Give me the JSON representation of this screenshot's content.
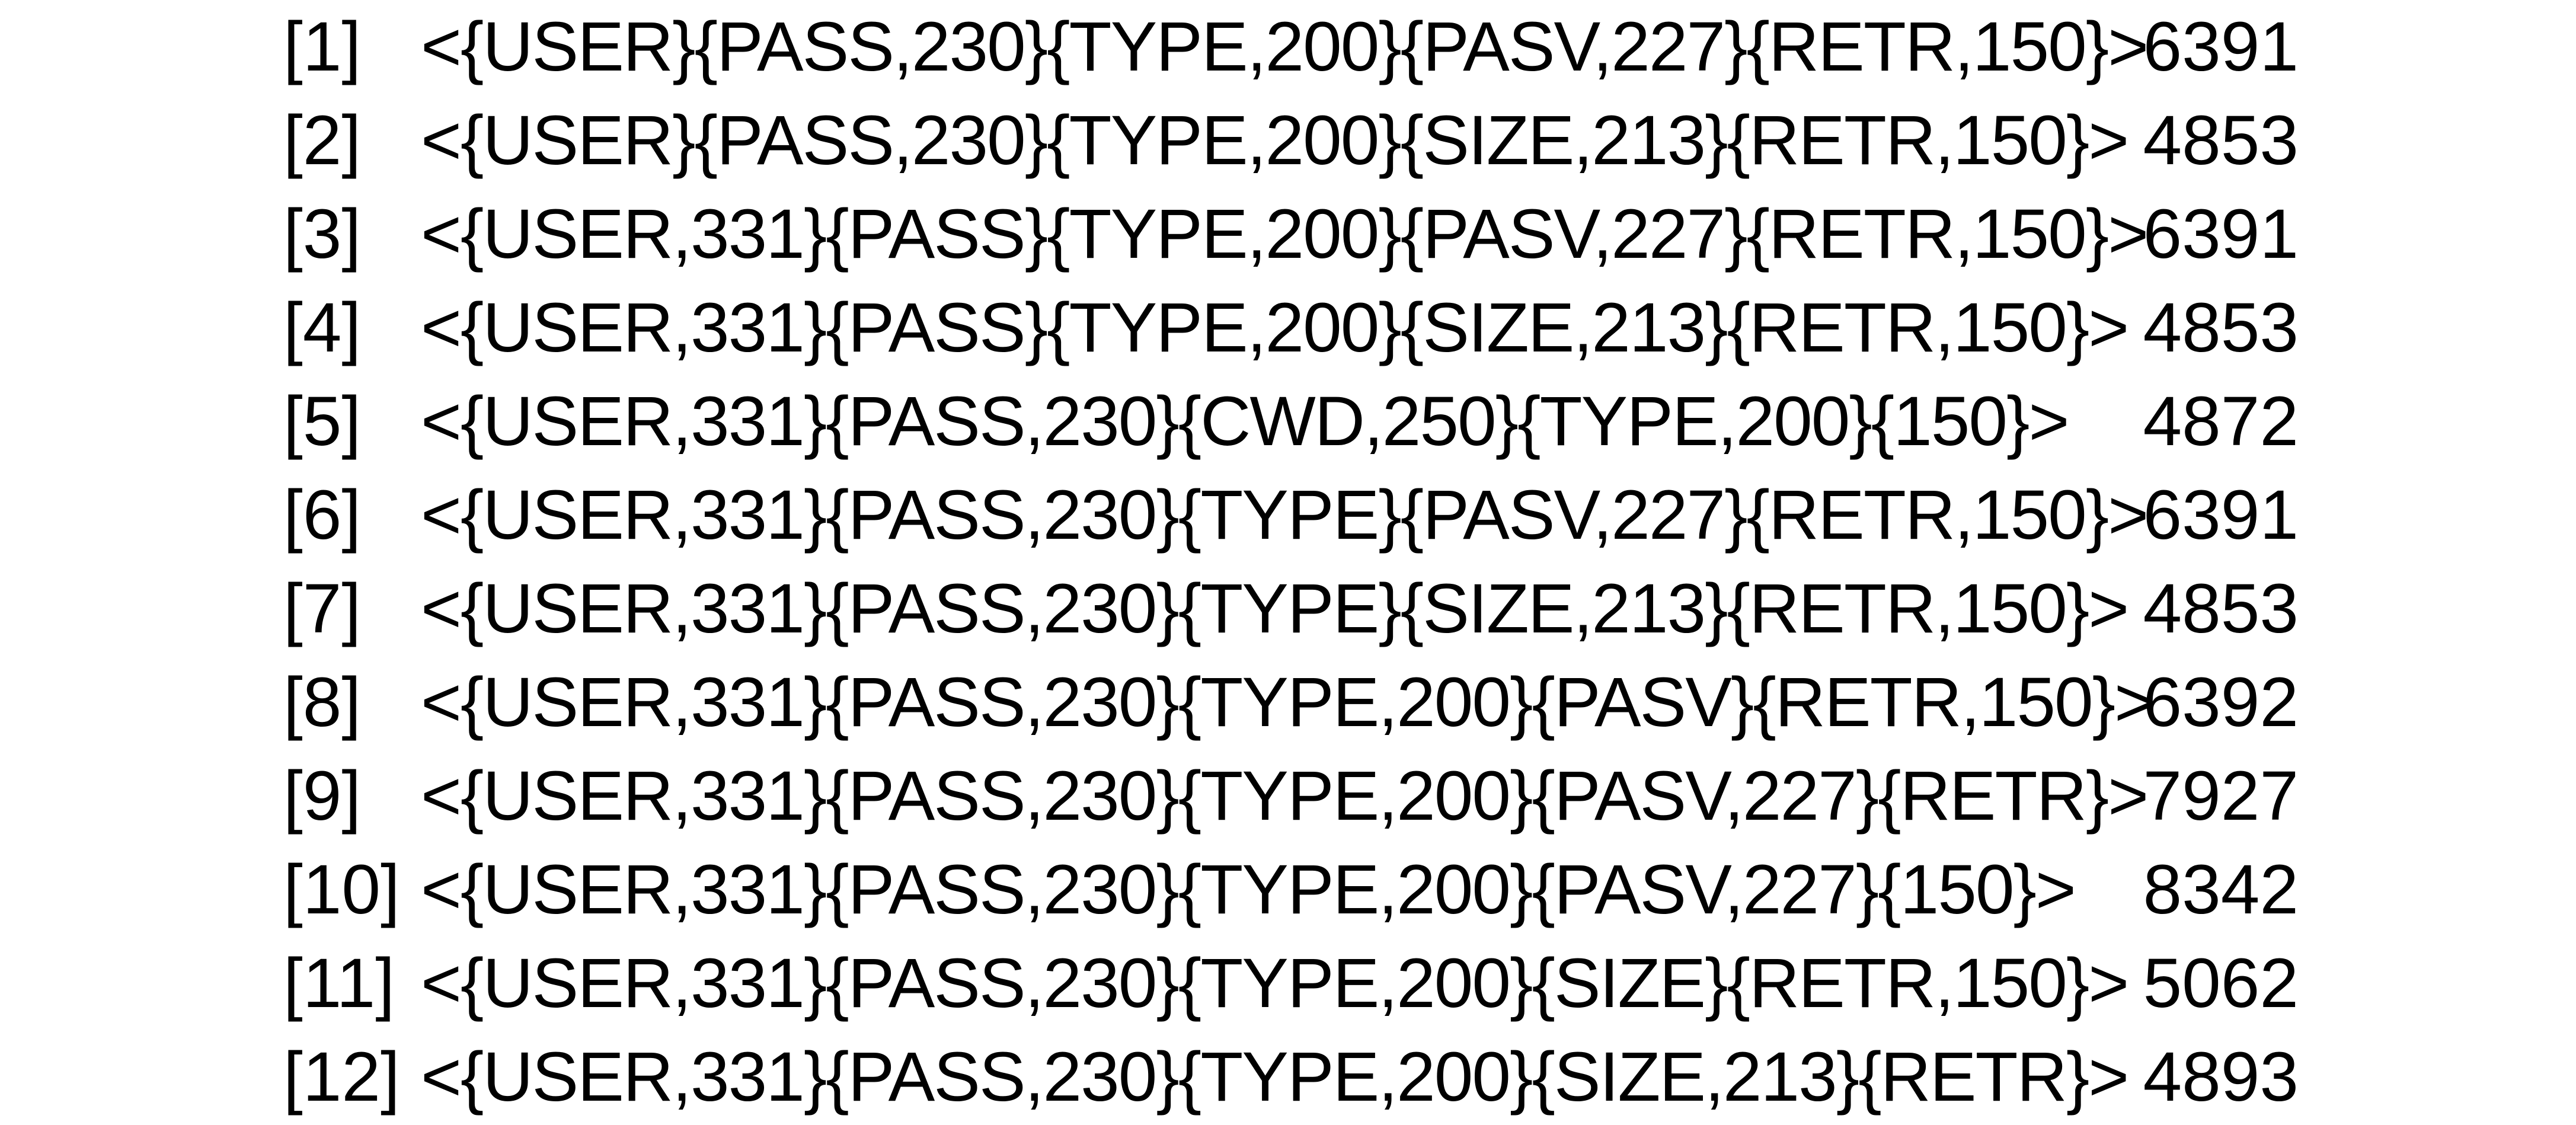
{
  "rows": [
    {
      "index": "[1]",
      "pattern": "<{USER}{PASS,230}{TYPE,200}{PASV,227}{RETR,150}>",
      "count": "6391"
    },
    {
      "index": "[2]",
      "pattern": "<{USER}{PASS,230}{TYPE,200}{SIZE,213}{RETR,150}>",
      "count": "4853"
    },
    {
      "index": "[3]",
      "pattern": "<{USER,331}{PASS}{TYPE,200}{PASV,227}{RETR,150}>",
      "count": "6391"
    },
    {
      "index": "[4]",
      "pattern": "<{USER,331}{PASS}{TYPE,200}{SIZE,213}{RETR,150}>",
      "count": "4853"
    },
    {
      "index": "[5]",
      "pattern": "<{USER,331}{PASS,230}{CWD,250}{TYPE,200}{150}>",
      "count": "4872"
    },
    {
      "index": "[6]",
      "pattern": "<{USER,331}{PASS,230}{TYPE}{PASV,227}{RETR,150}>",
      "count": "6391"
    },
    {
      "index": "[7]",
      "pattern": "<{USER,331}{PASS,230}{TYPE}{SIZE,213}{RETR,150}>",
      "count": "4853"
    },
    {
      "index": "[8]",
      "pattern": "<{USER,331}{PASS,230}{TYPE,200}{PASV}{RETR,150}>",
      "count": "6392"
    },
    {
      "index": "[9]",
      "pattern": "<{USER,331}{PASS,230}{TYPE,200}{PASV,227}{RETR}>",
      "count": "7927"
    },
    {
      "index": "[10]",
      "pattern": "<{USER,331}{PASS,230}{TYPE,200}{PASV,227}{150}>",
      "count": "8342"
    },
    {
      "index": "[11]",
      "pattern": "<{USER,331}{PASS,230}{TYPE,200}{SIZE}{RETR,150}>",
      "count": "5062"
    },
    {
      "index": "[12]",
      "pattern": "<{USER,331}{PASS,230}{TYPE,200}{SIZE,213}{RETR}>",
      "count": "4893"
    }
  ]
}
